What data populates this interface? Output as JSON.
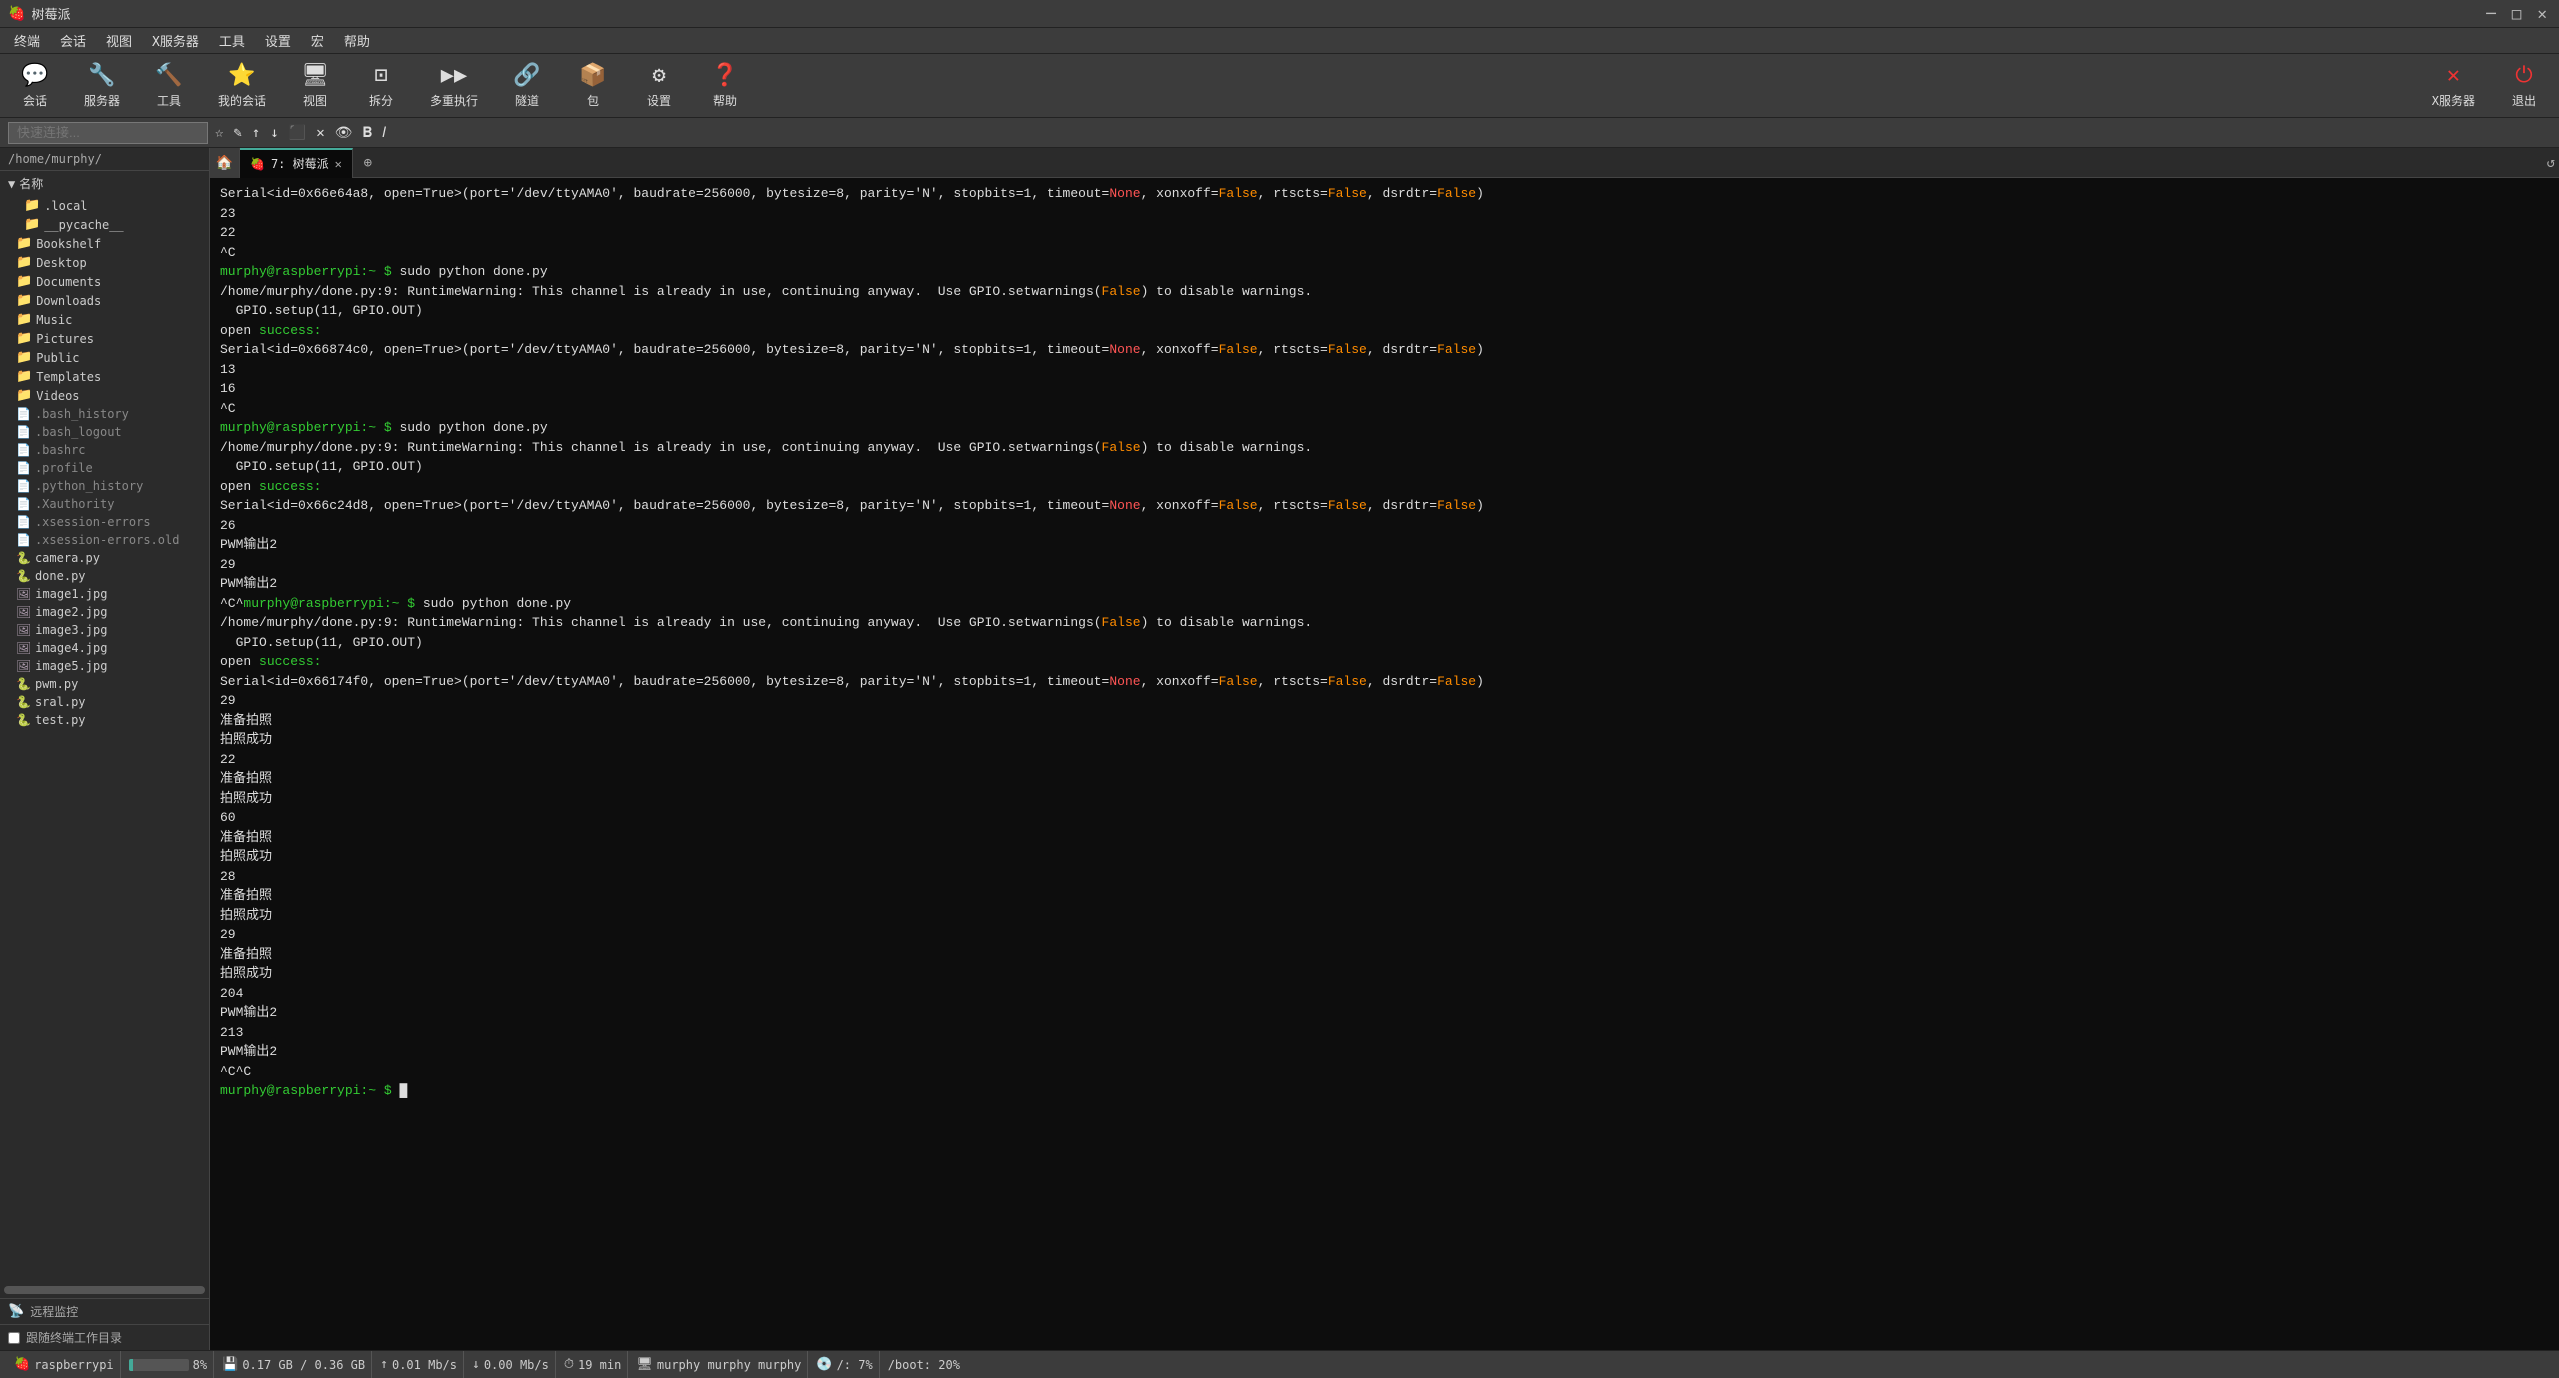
{
  "titleBar": {
    "appName": "树莓派",
    "controls": {
      "minimize": "─",
      "maximize": "□",
      "close": "✕"
    }
  },
  "menuBar": {
    "items": [
      "终端",
      "会话",
      "视图",
      "X服务器",
      "工具",
      "设置",
      "宏",
      "帮助"
    ]
  },
  "toolbar": {
    "items": [
      {
        "icon": "💬",
        "label": "会话"
      },
      {
        "icon": "🔧",
        "label": "服务器"
      },
      {
        "icon": "🔨",
        "label": "工具"
      },
      {
        "icon": "👤",
        "label": "我的会话"
      },
      {
        "icon": "🖥",
        "label": "视图"
      },
      {
        "icon": "✂",
        "label": "拆分"
      },
      {
        "icon": "▶▶",
        "label": "多重执行"
      },
      {
        "icon": "🔗",
        "label": "隧道"
      },
      {
        "icon": "📦",
        "label": "包"
      },
      {
        "icon": "⚙",
        "label": "设置"
      },
      {
        "icon": "❓",
        "label": "帮助"
      }
    ],
    "rightItems": [
      {
        "icon": "✕",
        "label": "X服务器"
      },
      {
        "icon": "⏻",
        "label": "退出"
      }
    ]
  },
  "quickConnect": {
    "placeholder": "快速连接..."
  },
  "sidebar": {
    "path": "/home/murphy/",
    "sectionLabel": "名称",
    "items": [
      {
        "type": "folder",
        "name": ".local",
        "indent": 1
      },
      {
        "type": "folder",
        "name": "__pycache__",
        "indent": 1
      },
      {
        "type": "folder",
        "name": "Bookshelf",
        "indent": 0
      },
      {
        "type": "folder",
        "name": "Desktop",
        "indent": 0
      },
      {
        "type": "folder",
        "name": "Documents",
        "indent": 0
      },
      {
        "type": "folder",
        "name": "Downloads",
        "indent": 0
      },
      {
        "type": "folder",
        "name": "Music",
        "indent": 0
      },
      {
        "type": "folder",
        "name": "Pictures",
        "indent": 0
      },
      {
        "type": "folder",
        "name": "Public",
        "indent": 0
      },
      {
        "type": "folder",
        "name": "Templates",
        "indent": 0
      },
      {
        "type": "folder",
        "name": "Videos",
        "indent": 0
      },
      {
        "type": "dotfile",
        "name": ".bash_history",
        "indent": 0
      },
      {
        "type": "dotfile",
        "name": ".bash_logout",
        "indent": 0
      },
      {
        "type": "dotfile",
        "name": ".bashrc",
        "indent": 0
      },
      {
        "type": "dotfile",
        "name": ".profile",
        "indent": 0
      },
      {
        "type": "dotfile",
        "name": ".python_history",
        "indent": 0
      },
      {
        "type": "dotfile",
        "name": ".Xauthority",
        "indent": 0
      },
      {
        "type": "dotfile",
        "name": ".xsession-errors",
        "indent": 0
      },
      {
        "type": "dotfile",
        "name": ".xsession-errors.old",
        "indent": 0
      },
      {
        "type": "py",
        "name": "camera.py",
        "indent": 0
      },
      {
        "type": "py",
        "name": "done.py",
        "indent": 0
      },
      {
        "type": "img",
        "name": "image1.jpg",
        "indent": 0
      },
      {
        "type": "img",
        "name": "image2.jpg",
        "indent": 0
      },
      {
        "type": "img",
        "name": "image3.jpg",
        "indent": 0
      },
      {
        "type": "img",
        "name": "image4.jpg",
        "indent": 0
      },
      {
        "type": "img",
        "name": "image5.jpg",
        "indent": 0
      },
      {
        "type": "py",
        "name": "pwm.py",
        "indent": 0
      },
      {
        "type": "py",
        "name": "sral.py",
        "indent": 0
      },
      {
        "type": "py",
        "name": "test.py",
        "indent": 0
      }
    ],
    "remoteMonitor": "远程监控",
    "followTerminalWorkdir": "跟随终端工作目录"
  },
  "tabs": [
    {
      "label": "7: 树莓派",
      "active": true
    }
  ],
  "terminal": {
    "lines": [
      {
        "parts": [
          {
            "text": "Serial<id=0x66e64a8, open=True>(port='/dev/ttyAMA0', baudrate=256000, bytesize=8, parity='N', stopbits=1, timeout=",
            "color": "white"
          },
          {
            "text": "None",
            "color": "red"
          },
          {
            "text": ", xonxoff=",
            "color": "white"
          },
          {
            "text": "False",
            "color": "orange"
          },
          {
            "text": ", rtscts=",
            "color": "white"
          },
          {
            "text": "False",
            "color": "orange"
          },
          {
            "text": ", dsrdtr=",
            "color": "white"
          },
          {
            "text": "False",
            "color": "orange"
          },
          {
            "text": ")",
            "color": "white"
          }
        ]
      },
      {
        "parts": [
          {
            "text": "23",
            "color": "white"
          }
        ]
      },
      {
        "parts": [
          {
            "text": "22",
            "color": "white"
          }
        ]
      },
      {
        "parts": [
          {
            "text": "^C",
            "color": "white"
          }
        ]
      },
      {
        "parts": [
          {
            "text": "murphy@raspberrypi:~ $ ",
            "color": "green"
          },
          {
            "text": "sudo python done.py",
            "color": "white"
          }
        ]
      },
      {
        "parts": [
          {
            "text": "/home/murphy/done.py:9: RuntimeWarning: This channel is already in use, continuing anyway.  Use GPIO.setwarnings(",
            "color": "white"
          },
          {
            "text": "False",
            "color": "orange"
          },
          {
            "text": ") to disable warnings.",
            "color": "white"
          }
        ]
      },
      {
        "parts": [
          {
            "text": "  GPIO.setup(11, GPIO.OUT)",
            "color": "white"
          }
        ]
      },
      {
        "parts": [
          {
            "text": "open ",
            "color": "white"
          },
          {
            "text": "success:",
            "color": "green"
          }
        ]
      },
      {
        "parts": [
          {
            "text": "Serial<id=0x66874c0, open=True>(port='/dev/ttyAMA0', baudrate=256000, bytesize=8, parity='N', stopbits=1, timeout=",
            "color": "white"
          },
          {
            "text": "None",
            "color": "red"
          },
          {
            "text": ", xonxoff=",
            "color": "white"
          },
          {
            "text": "False",
            "color": "orange"
          },
          {
            "text": ", rtscts=",
            "color": "white"
          },
          {
            "text": "False",
            "color": "orange"
          },
          {
            "text": ", dsrdtr=",
            "color": "white"
          },
          {
            "text": "False",
            "color": "orange"
          },
          {
            "text": ")",
            "color": "white"
          }
        ]
      },
      {
        "parts": [
          {
            "text": "13",
            "color": "white"
          }
        ]
      },
      {
        "parts": [
          {
            "text": "16",
            "color": "white"
          }
        ]
      },
      {
        "parts": [
          {
            "text": "^C",
            "color": "white"
          }
        ]
      },
      {
        "parts": [
          {
            "text": "murphy@raspberrypi:~ $ ",
            "color": "green"
          },
          {
            "text": "sudo python done.py",
            "color": "white"
          }
        ]
      },
      {
        "parts": [
          {
            "text": "/home/murphy/done.py:9: RuntimeWarning: This channel is already in use, continuing anyway.  Use GPIO.setwarnings(",
            "color": "white"
          },
          {
            "text": "False",
            "color": "orange"
          },
          {
            "text": ") to disable warnings.",
            "color": "white"
          }
        ]
      },
      {
        "parts": [
          {
            "text": "  GPIO.setup(11, GPIO.OUT)",
            "color": "white"
          }
        ]
      },
      {
        "parts": [
          {
            "text": "open ",
            "color": "white"
          },
          {
            "text": "success:",
            "color": "green"
          }
        ]
      },
      {
        "parts": [
          {
            "text": "Serial<id=0x66c24d8, open=True>(port='/dev/ttyAMA0', baudrate=256000, bytesize=8, parity='N', stopbits=1, timeout=",
            "color": "white"
          },
          {
            "text": "None",
            "color": "red"
          },
          {
            "text": ", xonxoff=",
            "color": "white"
          },
          {
            "text": "False",
            "color": "orange"
          },
          {
            "text": ", rtscts=",
            "color": "white"
          },
          {
            "text": "False",
            "color": "orange"
          },
          {
            "text": ", dsrdtr=",
            "color": "white"
          },
          {
            "text": "False",
            "color": "orange"
          },
          {
            "text": ")",
            "color": "white"
          }
        ]
      },
      {
        "parts": [
          {
            "text": "26",
            "color": "white"
          }
        ]
      },
      {
        "parts": [
          {
            "text": "PWM输出2",
            "color": "white"
          }
        ]
      },
      {
        "parts": [
          {
            "text": "29",
            "color": "white"
          }
        ]
      },
      {
        "parts": [
          {
            "text": "PWM输出2",
            "color": "white"
          }
        ]
      },
      {
        "parts": [
          {
            "text": "^C^",
            "color": "white"
          },
          {
            "text": "murphy@raspberrypi:~ $ ",
            "color": "green"
          },
          {
            "text": "sudo python done.py",
            "color": "white"
          }
        ]
      },
      {
        "parts": [
          {
            "text": "/home/murphy/done.py:9: RuntimeWarning: This channel is already in use, continuing anyway.  Use GPIO.setwarnings(",
            "color": "white"
          },
          {
            "text": "False",
            "color": "orange"
          },
          {
            "text": ") to disable warnings.",
            "color": "white"
          }
        ]
      },
      {
        "parts": [
          {
            "text": "  GPIO.setup(11, GPIO.OUT)",
            "color": "white"
          }
        ]
      },
      {
        "parts": [
          {
            "text": "open ",
            "color": "white"
          },
          {
            "text": "success:",
            "color": "green"
          }
        ]
      },
      {
        "parts": [
          {
            "text": "Serial<id=0x66174f0, open=True>(port='/dev/ttyAMA0', baudrate=256000, bytesize=8, parity='N', stopbits=1, timeout=",
            "color": "white"
          },
          {
            "text": "None",
            "color": "red"
          },
          {
            "text": ", xonxoff=",
            "color": "white"
          },
          {
            "text": "False",
            "color": "orange"
          },
          {
            "text": ", rtscts=",
            "color": "white"
          },
          {
            "text": "False",
            "color": "orange"
          },
          {
            "text": ", dsrdtr=",
            "color": "white"
          },
          {
            "text": "False",
            "color": "orange"
          },
          {
            "text": ")",
            "color": "white"
          }
        ]
      },
      {
        "parts": [
          {
            "text": "29",
            "color": "white"
          }
        ]
      },
      {
        "parts": [
          {
            "text": "准备拍照",
            "color": "white"
          }
        ]
      },
      {
        "parts": [
          {
            "text": "拍照成功",
            "color": "white"
          }
        ]
      },
      {
        "parts": [
          {
            "text": "22",
            "color": "white"
          }
        ]
      },
      {
        "parts": [
          {
            "text": "准备拍照",
            "color": "white"
          }
        ]
      },
      {
        "parts": [
          {
            "text": "拍照成功",
            "color": "white"
          }
        ]
      },
      {
        "parts": [
          {
            "text": "60",
            "color": "white"
          }
        ]
      },
      {
        "parts": [
          {
            "text": "准备拍照",
            "color": "white"
          }
        ]
      },
      {
        "parts": [
          {
            "text": "拍照成功",
            "color": "white"
          }
        ]
      },
      {
        "parts": [
          {
            "text": "28",
            "color": "white"
          }
        ]
      },
      {
        "parts": [
          {
            "text": "准备拍照",
            "color": "white"
          }
        ]
      },
      {
        "parts": [
          {
            "text": "拍照成功",
            "color": "white"
          }
        ]
      },
      {
        "parts": [
          {
            "text": "29",
            "color": "white"
          }
        ]
      },
      {
        "parts": [
          {
            "text": "准备拍照",
            "color": "white"
          }
        ]
      },
      {
        "parts": [
          {
            "text": "拍照成功",
            "color": "white"
          }
        ]
      },
      {
        "parts": [
          {
            "text": "204",
            "color": "white"
          }
        ]
      },
      {
        "parts": [
          {
            "text": "PWM输出2",
            "color": "white"
          }
        ]
      },
      {
        "parts": [
          {
            "text": "213",
            "color": "white"
          }
        ]
      },
      {
        "parts": [
          {
            "text": "PWM输出2",
            "color": "white"
          }
        ]
      },
      {
        "parts": [
          {
            "text": "^C^C",
            "color": "white"
          }
        ]
      },
      {
        "parts": [
          {
            "text": "murphy@raspberrypi:~ $ ",
            "color": "green"
          },
          {
            "text": "█",
            "color": "white"
          }
        ]
      }
    ]
  },
  "statusBar": {
    "raspberry": "raspberrypi",
    "cpuPercent": 8,
    "cpuLabel": "8%",
    "ramLabel": "0.17 GB / 0.36 GB",
    "uploadLabel": "0.01 Mb/s",
    "downloadLabel": "0.00 Mb/s",
    "timeLabel": "19 min",
    "sessionLabel": "murphy  murphy  murphy",
    "diskLabel": "/: 7%",
    "bootLabel": "/boot: 20%"
  }
}
